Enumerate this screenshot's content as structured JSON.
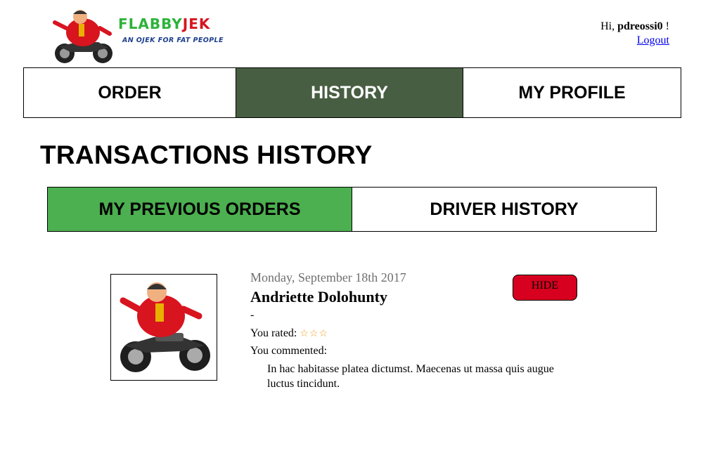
{
  "brand": {
    "title_part1": "FLABBY",
    "title_part2": "JEK",
    "tagline": "AN OJEK FOR FAT PEOPLE",
    "green": "#2db33a",
    "red": "#d8141f",
    "tagline_color": "#1c3f8e"
  },
  "user": {
    "greeting": "Hi,",
    "username": "pdreossi0",
    "exclaim": "!",
    "logout": "Logout"
  },
  "nav": {
    "tabs": [
      {
        "label": "ORDER"
      },
      {
        "label": "HISTORY",
        "active": true
      },
      {
        "label": "MY PROFILE"
      }
    ],
    "active_color": "#485e42"
  },
  "page": {
    "title": "TRANSACTIONS HISTORY"
  },
  "subtabs": {
    "items": [
      {
        "label": "MY PREVIOUS ORDERS",
        "active": true
      },
      {
        "label": "DRIVER HISTORY"
      }
    ],
    "active_color": "#4caf50"
  },
  "history": [
    {
      "date": "Monday, September 18th 2017",
      "driver": "Andriette Dolohunty",
      "route": "-",
      "rated_label": "You rated:",
      "stars": "☆☆☆",
      "rating": 3,
      "commented_label": "You commented:",
      "comment": "In hac habitasse platea dictumst. Maecenas ut massa quis augue luctus tincidunt.",
      "hide_label": "HIDE",
      "photo_icon": "driver-photo",
      "hide_color": "#d7001f"
    }
  ]
}
